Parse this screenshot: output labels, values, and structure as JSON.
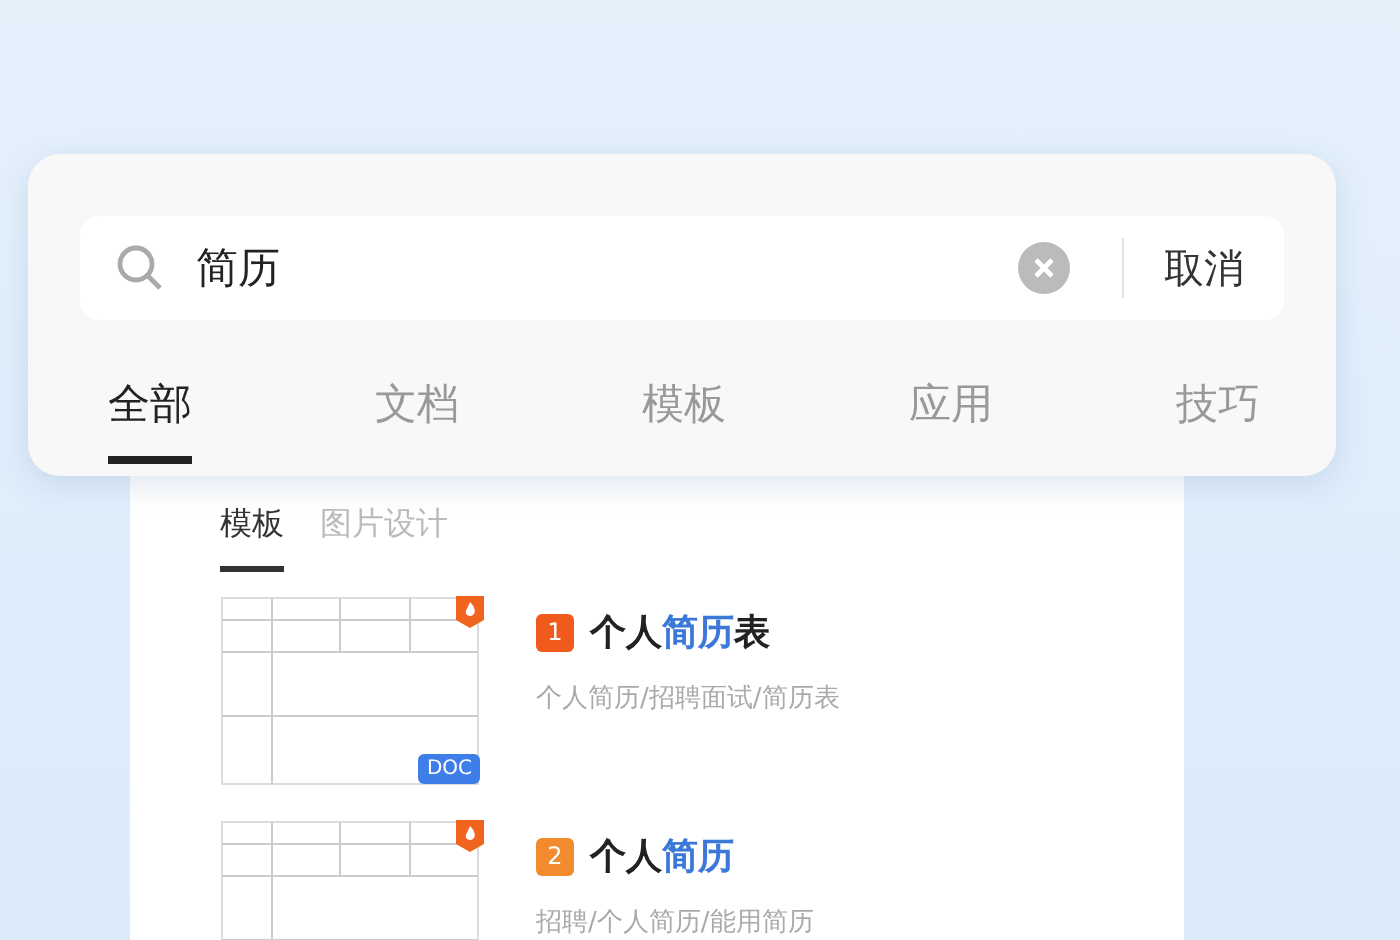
{
  "search": {
    "value": "简历",
    "cancel": "取消"
  },
  "tabs": [
    {
      "label": "全部",
      "selected": true
    },
    {
      "label": "文档",
      "selected": false
    },
    {
      "label": "模板",
      "selected": false
    },
    {
      "label": "应用",
      "selected": false
    },
    {
      "label": "技巧",
      "selected": false
    }
  ],
  "sub_tabs": [
    {
      "label": "模板",
      "selected": true
    },
    {
      "label": "图片设计",
      "selected": false
    }
  ],
  "results": [
    {
      "rank": "1",
      "color": "#f05a1a",
      "file_type": "DOC",
      "title": [
        {
          "text": "个人",
          "highlight": false
        },
        {
          "text": "简历",
          "highlight": true
        },
        {
          "text": "表",
          "highlight": false
        }
      ],
      "tags": "个人简历/招聘面试/简历表"
    },
    {
      "rank": "2",
      "color": "#f28a2e",
      "title": [
        {
          "text": "个人",
          "highlight": false
        },
        {
          "text": "简历",
          "highlight": true
        }
      ],
      "tags": "招聘/个人简历/能用简历"
    }
  ]
}
